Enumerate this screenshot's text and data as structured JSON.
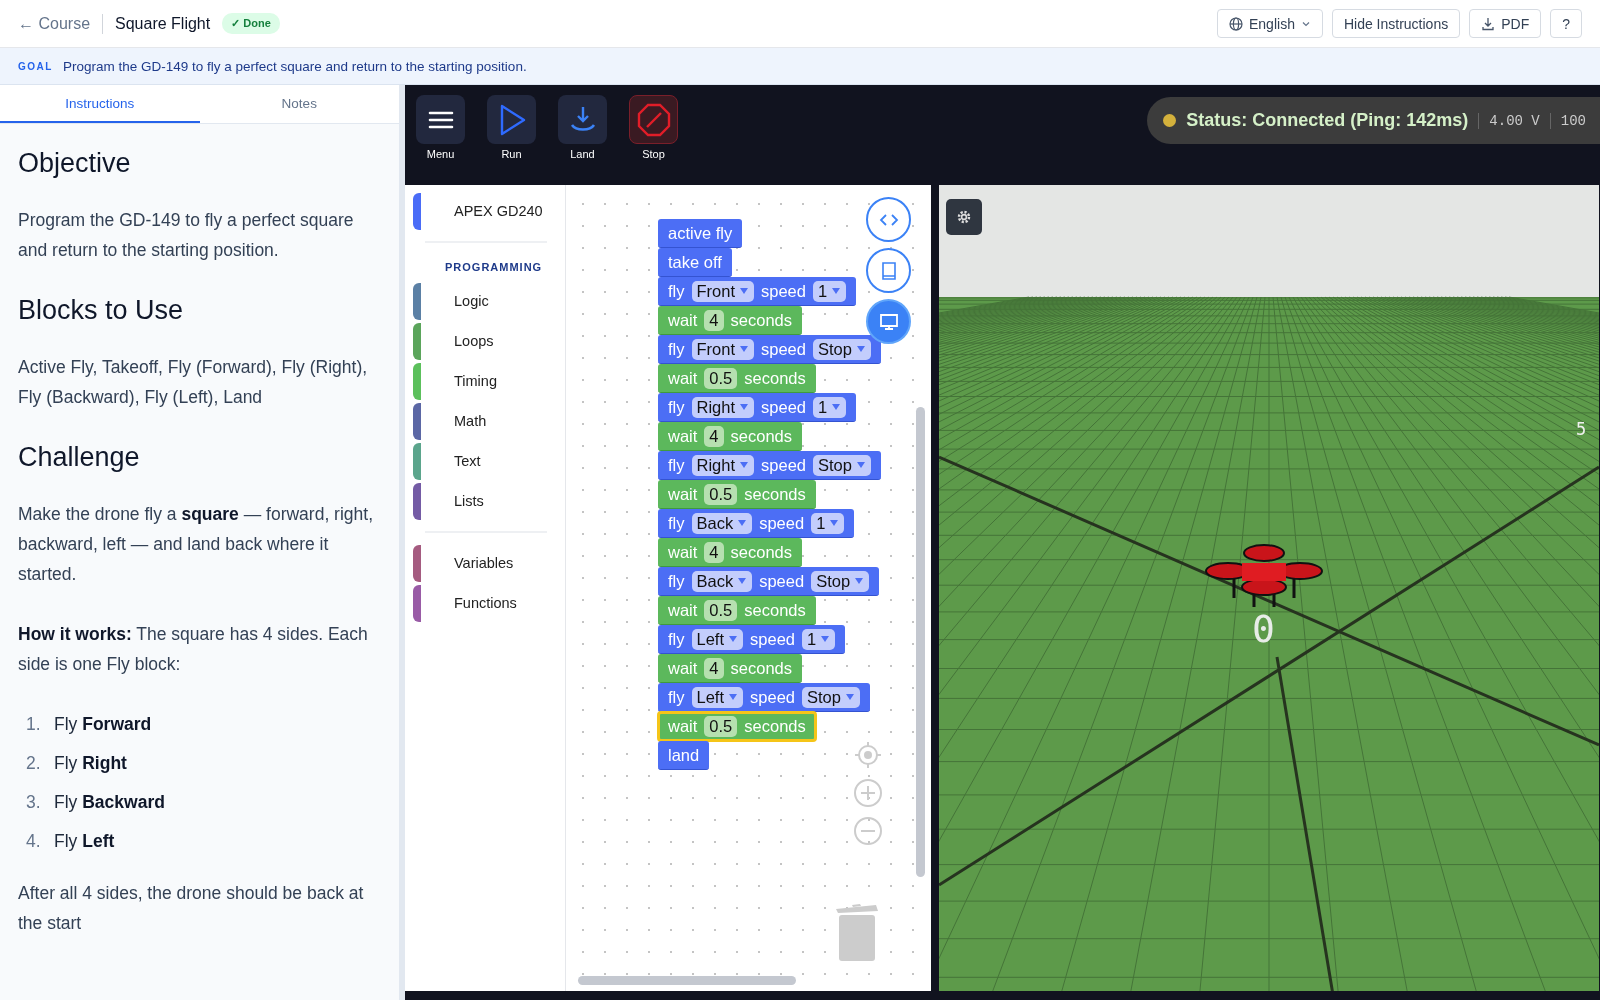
{
  "header": {
    "back_link": "← Course",
    "title": "Square Flight",
    "badge": "✓ Done",
    "language": "English",
    "buttons": [
      "Hide Instructions",
      "PDF",
      "?"
    ]
  },
  "goal": {
    "label": "GOAL",
    "text": "Program the GD-149 to fly a perfect square and return to the starting position."
  },
  "tabs": [
    {
      "label": "Instructions",
      "selected": true
    },
    {
      "label": "Notes",
      "selected": false
    }
  ],
  "instructions": [
    {
      "kind": "heading",
      "text": "Objective"
    },
    {
      "kind": "paragraph",
      "text": "Program the GD-149 to fly a perfect square and return to the starting position."
    },
    {
      "kind": "heading",
      "text": "Blocks to Use"
    },
    {
      "kind": "paragraph",
      "text": "Active Fly, Takeoff, Fly (Forward), Fly (Right), Fly (Backward), Fly (Left), Land"
    },
    {
      "kind": "heading",
      "text": "Challenge"
    },
    {
      "kind": "paragraph",
      "text": "Make the drone fly a **square** — forward, right, backward, left — and land back where it started."
    },
    {
      "kind": "paragraph",
      "text": "**How it works:** The square has 4 sides. Each side is one Fly block:"
    },
    {
      "kind": "steps",
      "items": [
        {
          "number": "1.",
          "text": "Fly **Forward**"
        },
        {
          "number": "2.",
          "text": "Fly **Right**"
        },
        {
          "number": "3.",
          "text": "Fly **Backward**"
        },
        {
          "number": "4.",
          "text": "Fly **Left**"
        }
      ]
    },
    {
      "kind": "paragraph",
      "text": "After all 4 sides, the drone should be back at the start"
    }
  ],
  "toolbar": [
    {
      "kind": "menu",
      "label": "Menu"
    },
    {
      "kind": "run",
      "label": "Run"
    },
    {
      "kind": "land",
      "label": "Land"
    },
    {
      "kind": "stop",
      "label": "Stop"
    }
  ],
  "status": {
    "text": "Status: Connected (Ping: 142ms)",
    "voltage": "4.00 V",
    "value": "100"
  },
  "toolbox": [
    {
      "items": [
        {
          "label": "APEX GD240",
          "color": "#4a6cf7"
        }
      ]
    },
    {
      "title": "PROGRAMMING",
      "items": [
        {
          "label": "Logic",
          "color": "#5b80a5"
        },
        {
          "label": "Loops",
          "color": "#5ba55b"
        },
        {
          "label": "Timing",
          "color": "#5cc05c"
        },
        {
          "label": "Math",
          "color": "#5b67a5"
        },
        {
          "label": "Text",
          "color": "#5ba58c"
        },
        {
          "label": "Lists",
          "color": "#745ba5"
        }
      ]
    },
    {
      "items": [
        {
          "label": "Variables",
          "color": "#a55b80"
        },
        {
          "label": "Functions",
          "color": "#995ba6"
        }
      ]
    }
  ],
  "blocks": [
    {
      "kind": "plain",
      "label": "active fly",
      "selected": false
    },
    {
      "kind": "plain",
      "label": "take off",
      "selected": false
    },
    {
      "kind": "fly",
      "label": "fly",
      "direction": "Front",
      "mid": "speed",
      "speed": "1",
      "selected": false
    },
    {
      "kind": "wait",
      "label": "wait",
      "value": "4",
      "unit": "seconds",
      "selected": false
    },
    {
      "kind": "fly",
      "label": "fly",
      "direction": "Front",
      "mid": "speed",
      "speed": "Stop",
      "selected": false
    },
    {
      "kind": "wait",
      "label": "wait",
      "value": "0.5",
      "unit": "seconds",
      "selected": false
    },
    {
      "kind": "fly",
      "label": "fly",
      "direction": "Right",
      "mid": "speed",
      "speed": "1",
      "selected": false
    },
    {
      "kind": "wait",
      "label": "wait",
      "value": "4",
      "unit": "seconds",
      "selected": false
    },
    {
      "kind": "fly",
      "label": "fly",
      "direction": "Right",
      "mid": "speed",
      "speed": "Stop",
      "selected": false
    },
    {
      "kind": "wait",
      "label": "wait",
      "value": "0.5",
      "unit": "seconds",
      "selected": false
    },
    {
      "kind": "fly",
      "label": "fly",
      "direction": "Back",
      "mid": "speed",
      "speed": "1",
      "selected": false
    },
    {
      "kind": "wait",
      "label": "wait",
      "value": "4",
      "unit": "seconds",
      "selected": false
    },
    {
      "kind": "fly",
      "label": "fly",
      "direction": "Back",
      "mid": "speed",
      "speed": "Stop",
      "selected": false
    },
    {
      "kind": "wait",
      "label": "wait",
      "value": "0.5",
      "unit": "seconds",
      "selected": false
    },
    {
      "kind": "fly",
      "label": "fly",
      "direction": "Left",
      "mid": "speed",
      "speed": "1",
      "selected": false
    },
    {
      "kind": "wait",
      "label": "wait",
      "value": "4",
      "unit": "seconds",
      "selected": false
    },
    {
      "kind": "fly",
      "label": "fly",
      "direction": "Left",
      "mid": "speed",
      "speed": "Stop",
      "selected": false
    },
    {
      "kind": "wait",
      "label": "wait",
      "value": "0.5",
      "unit": "seconds",
      "selected": true
    },
    {
      "kind": "plain",
      "label": "land",
      "selected": false
    }
  ],
  "scene": {
    "markers": [
      "0",
      "5"
    ]
  }
}
